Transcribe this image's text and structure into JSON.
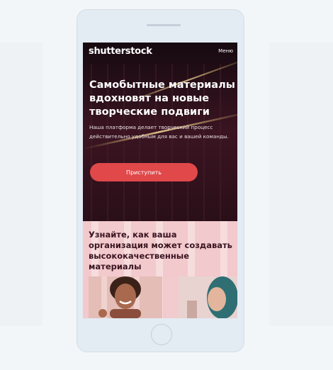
{
  "header": {
    "logo": "shutterstock",
    "menu_label": "Меню"
  },
  "hero": {
    "title": "Самобытные материалы вдохновят на новые творческие подвиги",
    "subtitle": "Наша платформа делает творческий процесс действительно удобным для вас и вашей команды.",
    "cta_label": "Приступить"
  },
  "section2": {
    "title": "Узнайте, как ваша организация может создавать высококачественные материалы"
  },
  "colors": {
    "hero_bg": "#1c0d13",
    "cta": "#e0484a",
    "section2_bg": "#f2c9cc",
    "section2_text": "#3a1420",
    "page_bg": "#f3f6f9",
    "phone_body": "#e3ebf3"
  }
}
